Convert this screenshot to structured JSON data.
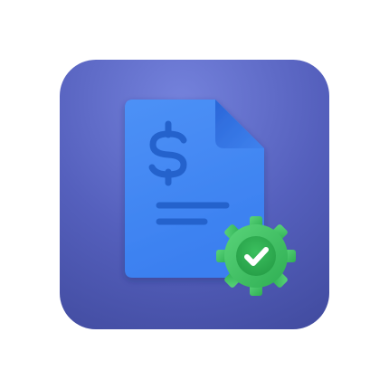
{
  "app_icon": {
    "icon_name": "invoice-approved-icon",
    "colors": {
      "background_top": "#6a78d6",
      "background_bottom": "#4650a8",
      "document": "#3f86f2",
      "document_fold": "#2f6fe0",
      "glyph": "#2360c8",
      "badge_gear": "#3cc061",
      "badge_center": "#2fa84f",
      "check": "#ffffff"
    },
    "document": {
      "symbol": "$",
      "text_lines": 2
    },
    "badge": {
      "icon_name": "gear-check-icon",
      "status": "approved"
    }
  }
}
